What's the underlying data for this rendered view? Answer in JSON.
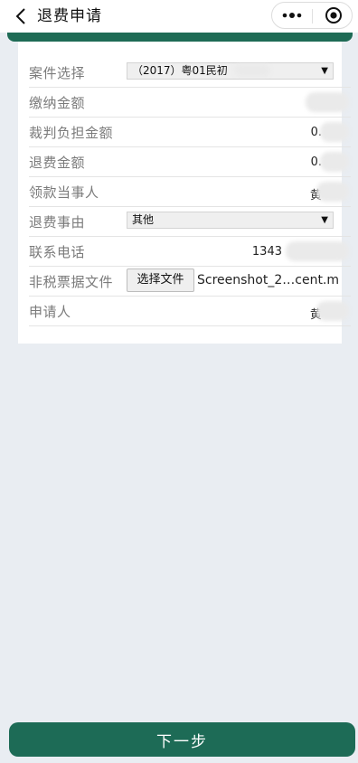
{
  "header": {
    "title": "退费申请",
    "back_icon": "chevron-left-icon",
    "more_icon": "more-dots-icon",
    "close_icon": "target-close-icon"
  },
  "form": {
    "case_select": {
      "label": "案件选择",
      "value": "（2017）粤01民初"
    },
    "payment_amount": {
      "label": "缴纳金额",
      "value": ""
    },
    "judged_amount": {
      "label": "裁判负担金额",
      "value": "0."
    },
    "refund_amount": {
      "label": "退费金额",
      "value": "0."
    },
    "payee": {
      "label": "领款当事人",
      "value": "黄"
    },
    "refund_reason": {
      "label": "退费事由",
      "value": "其他"
    },
    "phone": {
      "label": "联系电话",
      "value": "1343"
    },
    "non_tax_file": {
      "label": "非税票据文件",
      "button": "选择文件",
      "file_name": "Screenshot_2…cent.m"
    },
    "applicant": {
      "label": "申请人",
      "value": "黄"
    }
  },
  "footer": {
    "next_label": "下一步"
  },
  "colors": {
    "brand_green": "#1d6b56",
    "background": "#e9edf2"
  }
}
